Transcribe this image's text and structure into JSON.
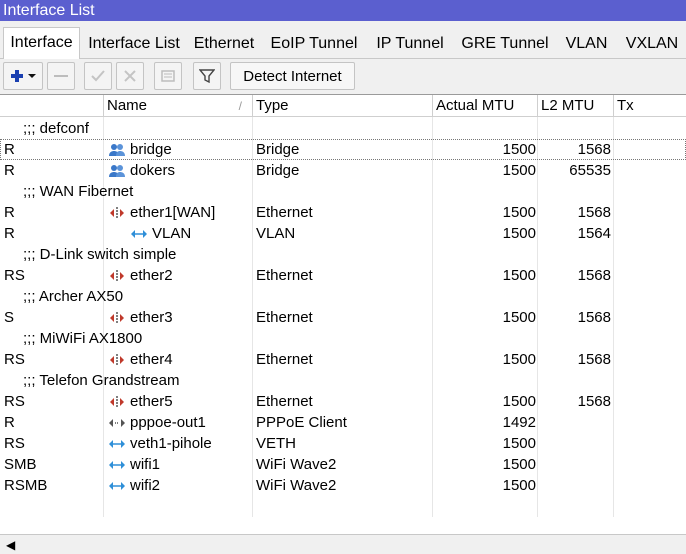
{
  "window": {
    "title": "Interface List"
  },
  "tabs": [
    {
      "label": "Interface"
    },
    {
      "label": "Interface List"
    },
    {
      "label": "Ethernet"
    },
    {
      "label": "EoIP Tunnel"
    },
    {
      "label": "IP Tunnel"
    },
    {
      "label": "GRE Tunnel"
    },
    {
      "label": "VLAN"
    },
    {
      "label": "VXLAN"
    }
  ],
  "toolbar": {
    "add_icon": "plus-icon",
    "remove_icon": "minus-icon",
    "enable_icon": "check-icon",
    "disable_icon": "cross-icon",
    "comment_icon": "comment-icon",
    "filter_icon": "filter-icon",
    "detect_label": "Detect Internet"
  },
  "columns": {
    "flags": "",
    "name": "Name",
    "name_sort": "/",
    "type": "Type",
    "mtu": "Actual MTU",
    "l2mtu": "L2 MTU",
    "tx": "Tx"
  },
  "rows": [
    {
      "kind": "comment",
      "text": ";;; defconf"
    },
    {
      "kind": "item",
      "flags": "R",
      "icon": "bridge-icon",
      "name": "bridge",
      "type": "Bridge",
      "mtu": "1500",
      "l2mtu": "1568"
    },
    {
      "kind": "item",
      "flags": "R",
      "icon": "bridge-icon",
      "name": "dokers",
      "type": "Bridge",
      "mtu": "1500",
      "l2mtu": "65535"
    },
    {
      "kind": "comment",
      "text": ";;; WAN Fibernet"
    },
    {
      "kind": "item",
      "flags": "R",
      "icon": "ethernet-icon",
      "name": "ether1[WAN]",
      "type": "Ethernet",
      "mtu": "1500",
      "l2mtu": "1568"
    },
    {
      "kind": "item",
      "flags": "R",
      "icon": "vlan-icon",
      "name": "VLAN",
      "type": "VLAN",
      "mtu": "1500",
      "l2mtu": "1564",
      "indent": true
    },
    {
      "kind": "comment",
      "text": ";;; D-Link switch simple"
    },
    {
      "kind": "item",
      "flags": "RS",
      "icon": "ethernet-icon",
      "name": "ether2",
      "type": "Ethernet",
      "mtu": "1500",
      "l2mtu": "1568"
    },
    {
      "kind": "comment",
      "text": ";;; Archer AX50"
    },
    {
      "kind": "item",
      "flags": "S",
      "icon": "ethernet-icon",
      "name": "ether3",
      "type": "Ethernet",
      "mtu": "1500",
      "l2mtu": "1568"
    },
    {
      "kind": "comment",
      "text": ";;; MiWiFi AX1800"
    },
    {
      "kind": "item",
      "flags": "RS",
      "icon": "ethernet-icon",
      "name": "ether4",
      "type": "Ethernet",
      "mtu": "1500",
      "l2mtu": "1568"
    },
    {
      "kind": "comment",
      "text": ";;; Telefon Grandstream"
    },
    {
      "kind": "item",
      "flags": "RS",
      "icon": "ethernet-icon",
      "name": "ether5",
      "type": "Ethernet",
      "mtu": "1500",
      "l2mtu": "1568"
    },
    {
      "kind": "item",
      "flags": "R",
      "icon": "pppoe-icon",
      "name": "pppoe-out1",
      "type": "PPPoE Client",
      "mtu": "1492",
      "l2mtu": ""
    },
    {
      "kind": "item",
      "flags": "RS",
      "icon": "veth-icon",
      "name": "veth1-pihole",
      "type": "VETH",
      "mtu": "1500",
      "l2mtu": ""
    },
    {
      "kind": "item",
      "flags": "SMB",
      "icon": "wifi-icon",
      "name": "wifi1",
      "type": "WiFi Wave2",
      "mtu": "1500",
      "l2mtu": ""
    },
    {
      "kind": "item",
      "flags": "RSMB",
      "icon": "wifi-icon",
      "name": "wifi2",
      "type": "WiFi Wave2",
      "mtu": "1500",
      "l2mtu": ""
    }
  ],
  "colors": {
    "titlebar": "#5b5fcf",
    "bridge_icon": "#3a78c9",
    "ethernet_icon": "#c0392b",
    "link_icon": "#2f8fd8",
    "add_icon": "#1a3fb0"
  },
  "scrollbar": {
    "left_arrow_icon": "left-arrow-icon"
  }
}
